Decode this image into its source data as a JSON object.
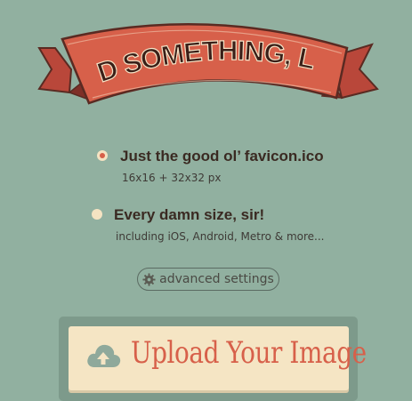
{
  "banner": {
    "text": "NEED SOMETHING, LAD?"
  },
  "options": [
    {
      "title": "Just the good ol’ favicon.ico",
      "subtitle": "16x16 + 32x32 px",
      "selected": true
    },
    {
      "title": "Every damn size, sir!",
      "subtitle": "including iOS, Android, Metro & more...",
      "selected": false
    }
  ],
  "advanced": {
    "label": "advanced settings",
    "icon": "gear-icon"
  },
  "upload": {
    "label": "Upload Your Image",
    "icon": "cloud-upload-icon"
  },
  "colors": {
    "background": "#91b0a0",
    "banner_red": "#d7604a",
    "cream": "#f5e3c2",
    "text_dark": "#3a2a22"
  }
}
